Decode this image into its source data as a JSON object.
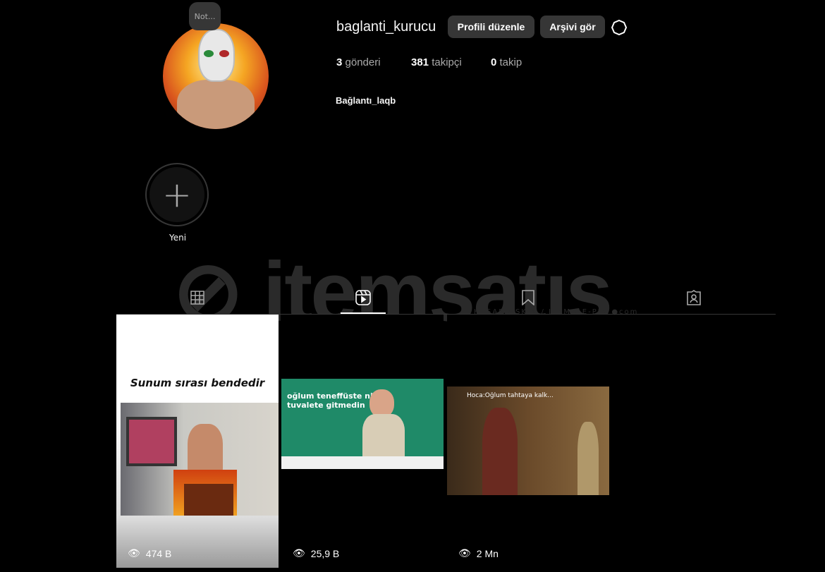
{
  "note": "Not...",
  "profile": {
    "username": "baglanti_kurucu",
    "edit_label": "Profili düzenle",
    "archive_label": "Arşivi gör",
    "posts_count": "3",
    "posts_label": "gönderi",
    "followers_count": "381",
    "followers_label": "takipçi",
    "following_count": "0",
    "following_label": "takip",
    "bio_name": "Bağlantı_laqb"
  },
  "highlight": {
    "new_label": "Yeni"
  },
  "watermark": {
    "brand": "itemsatıs",
    "sub": "HESAP / SKIN / ITEM / E-PIN .com"
  },
  "tabs": [
    {
      "icon": "grid-icon"
    },
    {
      "icon": "reels-icon",
      "active": true
    },
    {
      "icon": "bookmark-icon"
    },
    {
      "icon": "tagged-icon"
    }
  ],
  "reels": [
    {
      "caption": "Sunum sırası bendedir",
      "views": "474 B"
    },
    {
      "caption": "oğlum teneffüste niye tuvalete gitmedin",
      "views": "25,9 B"
    },
    {
      "caption": "Hoca:Oğlum tahtaya kalk...",
      "views": "2 Mn"
    }
  ]
}
